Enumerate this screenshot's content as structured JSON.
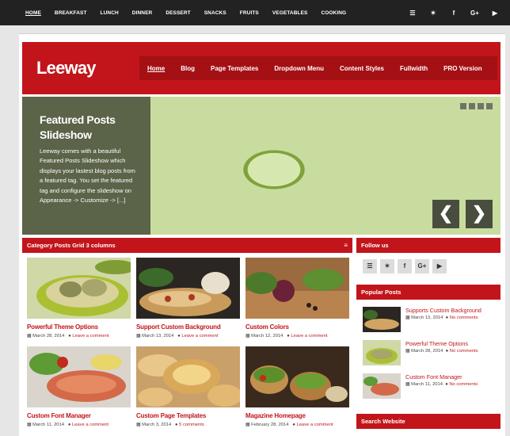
{
  "topbar": {
    "nav": [
      "HOME",
      "BREAKFAST",
      "LUNCH",
      "DINNER",
      "DESSERT",
      "SNACKS",
      "FRUITS",
      "VEGETABLES",
      "COOKING"
    ],
    "social": [
      {
        "icon": "rss-icon",
        "glyph": "☰"
      },
      {
        "icon": "twitter-icon",
        "glyph": "✶"
      },
      {
        "icon": "facebook-icon",
        "glyph": "f"
      },
      {
        "icon": "google-plus-icon",
        "glyph": "G+"
      },
      {
        "icon": "youtube-icon",
        "glyph": "▶"
      }
    ]
  },
  "header": {
    "logo": "Leeway",
    "nav": [
      "Home",
      "Blog",
      "Page Templates",
      "Dropdown Menu",
      "Content Styles",
      "Fullwidth",
      "PRO Version"
    ]
  },
  "slider": {
    "title": "Featured Posts Slideshow",
    "text": "Leeway comes with a beautiful Featured Posts Slideshow which displays your lastest blog posts from a featured tag. You set the featured tag and configure the slideshow on Appearance -> Customize -> [...]",
    "prev": "❮",
    "next": "❯"
  },
  "grid": {
    "title": "Category Posts Grid 3 columns",
    "menu_icon": "≡",
    "posts": [
      {
        "title": "Powerful Theme Options",
        "date": "March 28, 2014",
        "comments": "Leave a comment"
      },
      {
        "title": "Support Custom Background",
        "date": "March 13, 2014",
        "comments": "Leave a comment"
      },
      {
        "title": "Custom Colors",
        "date": "March 12, 2014",
        "comments": "Leave a comment"
      },
      {
        "title": "Custom Font Manager",
        "date": "March 11, 2014",
        "comments": "Leave a comment"
      },
      {
        "title": "Custom Page Templates",
        "date": "March 3, 2014",
        "comments": "5 comments"
      },
      {
        "title": "Magazine Homepage",
        "date": "February 28, 2014",
        "comments": "Leave a comment"
      }
    ]
  },
  "sidebar": {
    "follow_title": "Follow us",
    "follow_icons": [
      "☰",
      "✶",
      "f",
      "G+",
      "▶"
    ],
    "popular_title": "Popular Posts",
    "popular": [
      {
        "title": "Supports Custom Background",
        "date": "March 13, 2014",
        "comments": "No comments"
      },
      {
        "title": "Powerful Theme Options",
        "date": "March 28, 2014",
        "comments": "No comments"
      },
      {
        "title": "Custom Font Manager",
        "date": "March 11, 2014",
        "comments": "No comments"
      }
    ],
    "search_title": "Search Website"
  },
  "colors": {
    "accent": "#c2151b",
    "topbar": "#222222"
  }
}
